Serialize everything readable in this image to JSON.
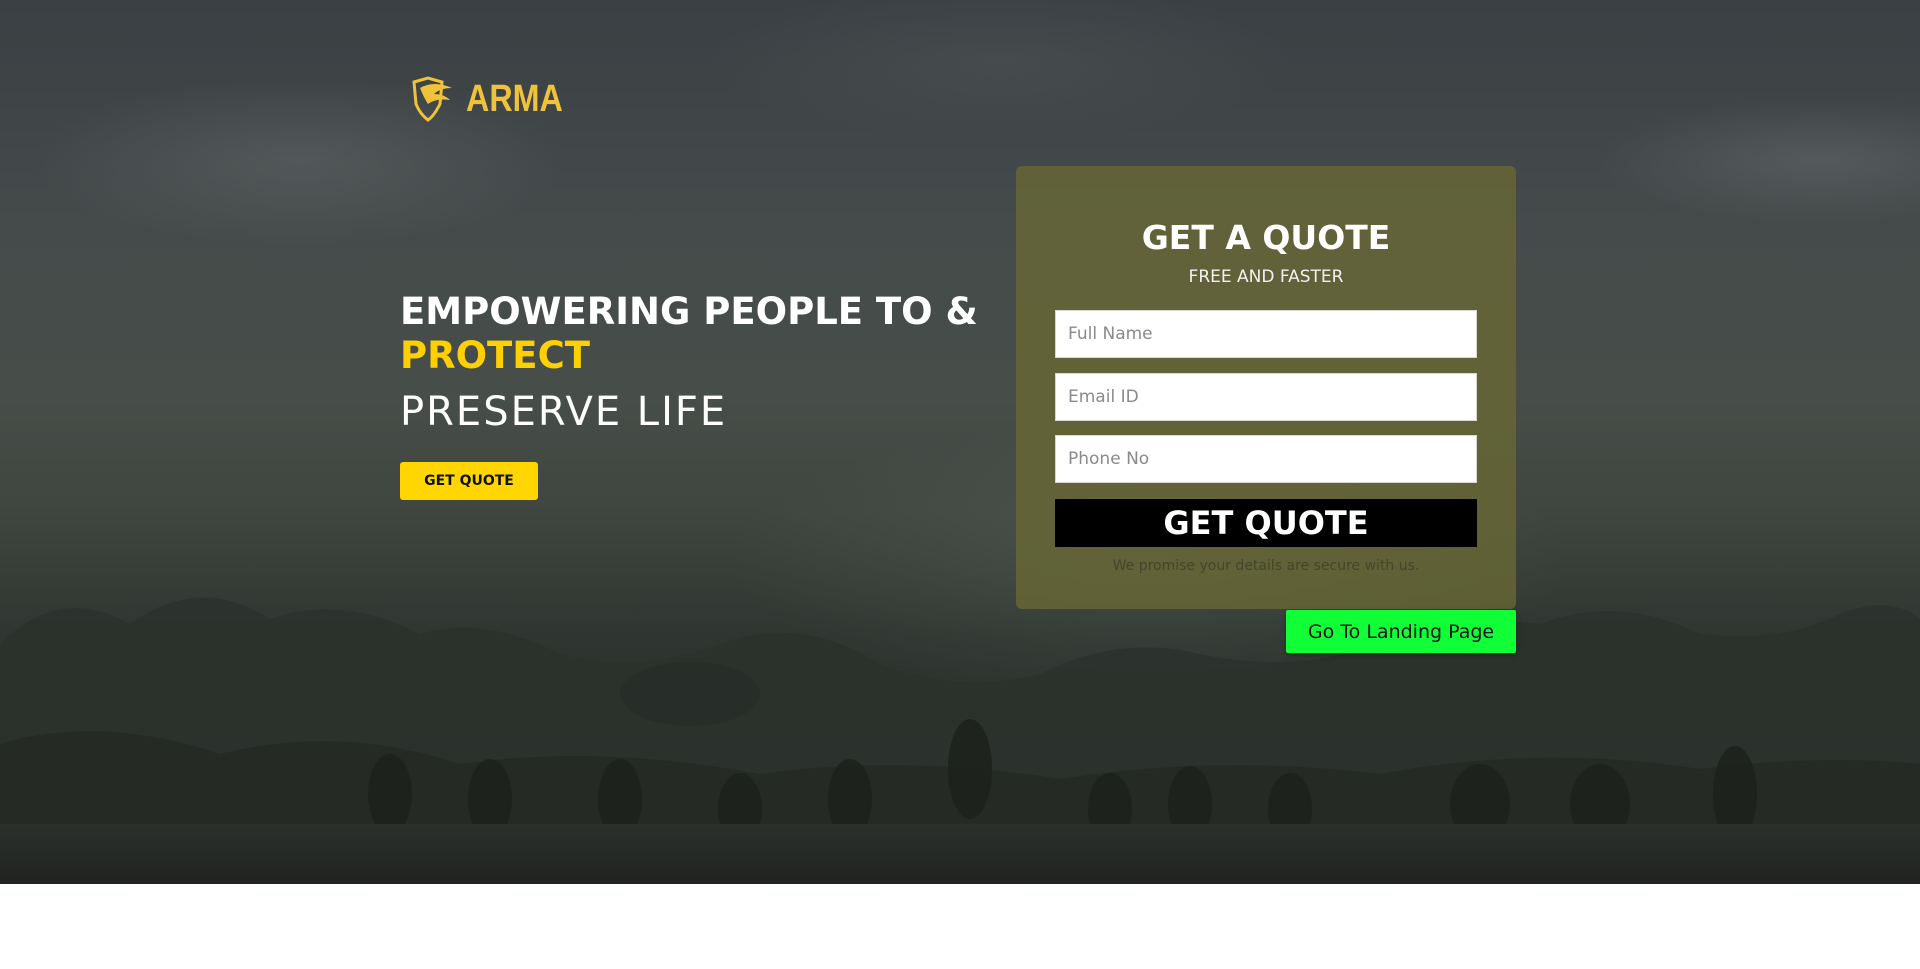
{
  "brand": {
    "name": "ARMA",
    "logo_icon": "eagle-shield-icon",
    "accent": "#f0c23c"
  },
  "hero": {
    "line1": "EMPOWERING PEOPLE TO &",
    "line2": "PROTECT",
    "line3": "PRESERVE LIFE",
    "cta_label": "GET QUOTE",
    "cta_color": "#ffd600",
    "highlight_color": "#ffd000"
  },
  "quote_form": {
    "title": "GET A QUOTE",
    "subtitle": "FREE AND FASTER",
    "fields": {
      "name_placeholder": "Full Name",
      "email_placeholder": "Email ID",
      "phone_placeholder": "Phone No"
    },
    "submit_label": "GET QUOTE",
    "promise_text": "We promise your details are secure with us."
  },
  "landing_button": {
    "label": "Go To Landing Page",
    "color": "#10ff36"
  }
}
